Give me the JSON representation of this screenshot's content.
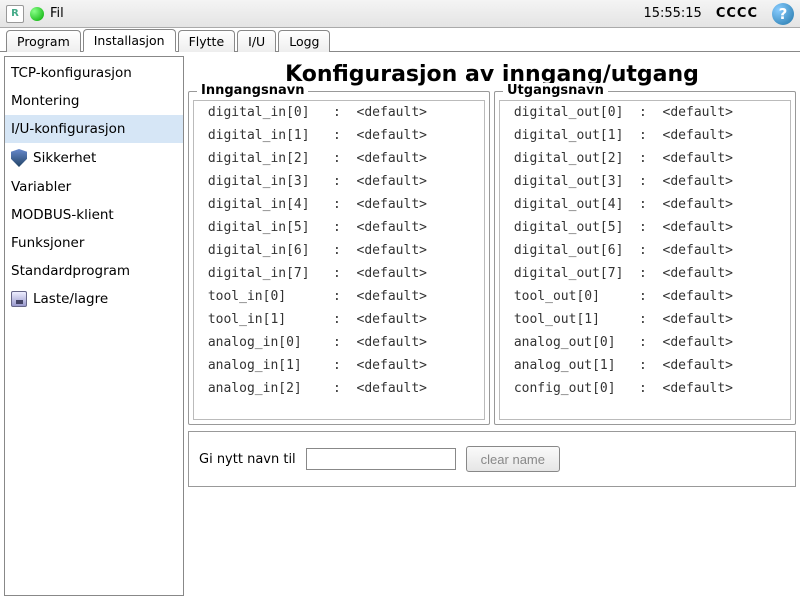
{
  "topbar": {
    "logo_text": "R",
    "menu_fil": "Fil",
    "time": "15:55:15",
    "cccc": "CCCC"
  },
  "tabs": [
    {
      "label": "Program",
      "active": false
    },
    {
      "label": "Installasjon",
      "active": true
    },
    {
      "label": "Flytte",
      "active": false
    },
    {
      "label": "I/U",
      "active": false
    },
    {
      "label": "Logg",
      "active": false
    }
  ],
  "sidebar": [
    {
      "label": "TCP-konfigurasjon",
      "icon": null,
      "selected": false
    },
    {
      "label": "Montering",
      "icon": null,
      "selected": false
    },
    {
      "label": "I/U-konfigurasjon",
      "icon": null,
      "selected": true
    },
    {
      "label": "Sikkerhet",
      "icon": "shield",
      "selected": false
    },
    {
      "label": "Variabler",
      "icon": null,
      "selected": false
    },
    {
      "label": "MODBUS-klient",
      "icon": null,
      "selected": false
    },
    {
      "label": "Funksjoner",
      "icon": null,
      "selected": false
    },
    {
      "label": "Standardprogram",
      "icon": null,
      "selected": false
    },
    {
      "label": "Laste/lagre",
      "icon": "disk",
      "selected": false
    }
  ],
  "main": {
    "title": "Konfigurasjon av inngang/utgang",
    "input_legend": "Inngangsnavn",
    "output_legend": "Utgangsnavn",
    "inputs": [
      {
        "name": "digital_in[0]",
        "value": "<default>"
      },
      {
        "name": "digital_in[1]",
        "value": "<default>"
      },
      {
        "name": "digital_in[2]",
        "value": "<default>"
      },
      {
        "name": "digital_in[3]",
        "value": "<default>"
      },
      {
        "name": "digital_in[4]",
        "value": "<default>"
      },
      {
        "name": "digital_in[5]",
        "value": "<default>"
      },
      {
        "name": "digital_in[6]",
        "value": "<default>"
      },
      {
        "name": "digital_in[7]",
        "value": "<default>"
      },
      {
        "name": "tool_in[0]",
        "value": "<default>"
      },
      {
        "name": "tool_in[1]",
        "value": "<default>"
      },
      {
        "name": "analog_in[0]",
        "value": "<default>"
      },
      {
        "name": "analog_in[1]",
        "value": "<default>"
      },
      {
        "name": "analog_in[2]",
        "value": "<default>"
      }
    ],
    "outputs": [
      {
        "name": "digital_out[0]",
        "value": "<default>"
      },
      {
        "name": "digital_out[1]",
        "value": "<default>"
      },
      {
        "name": "digital_out[2]",
        "value": "<default>"
      },
      {
        "name": "digital_out[3]",
        "value": "<default>"
      },
      {
        "name": "digital_out[4]",
        "value": "<default>"
      },
      {
        "name": "digital_out[5]",
        "value": "<default>"
      },
      {
        "name": "digital_out[6]",
        "value": "<default>"
      },
      {
        "name": "digital_out[7]",
        "value": "<default>"
      },
      {
        "name": "tool_out[0]",
        "value": "<default>"
      },
      {
        "name": "tool_out[1]",
        "value": "<default>"
      },
      {
        "name": "analog_out[0]",
        "value": "<default>"
      },
      {
        "name": "analog_out[1]",
        "value": "<default>"
      },
      {
        "name": "config_out[0]",
        "value": "<default>"
      }
    ],
    "rename_label": "Gi nytt navn til",
    "rename_value": "",
    "clear_btn": "clear name"
  }
}
